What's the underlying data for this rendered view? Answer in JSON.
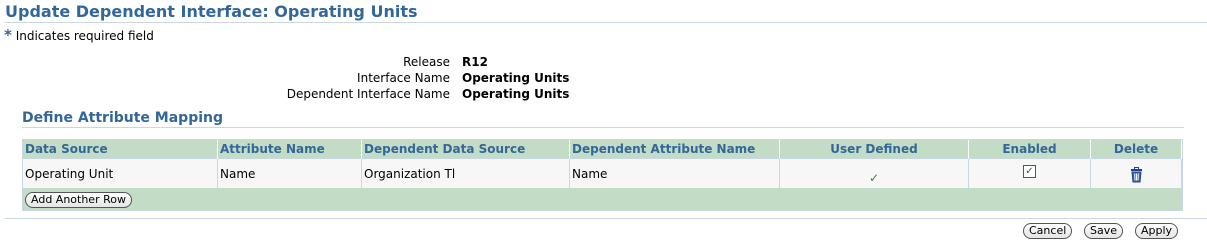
{
  "page": {
    "title": "Update Dependent Interface: Operating Units",
    "required_star": "*",
    "required_note": "Indicates required field"
  },
  "info": [
    {
      "label": "Release",
      "value": "R12"
    },
    {
      "label": "Interface Name",
      "value": "Operating Units"
    },
    {
      "label": "Dependent Interface Name",
      "value": "Operating Units"
    }
  ],
  "section": {
    "title": "Define Attribute Mapping"
  },
  "table": {
    "headers": [
      "Data Source",
      "Attribute Name",
      "Dependent Data Source",
      "Dependent Attribute Name",
      "User Defined",
      "Enabled",
      "Delete"
    ],
    "rows": [
      {
        "data_source": "Operating Unit",
        "attribute_name": "Name",
        "dependent_data_source": "Organization Tl",
        "dependent_attribute_name": "Name",
        "user_defined": true,
        "enabled": true
      }
    ],
    "add_row_label": "Add Another Row"
  },
  "icons": {
    "user_defined": "check-icon",
    "enabled": "checkbox-checked",
    "delete": "trash-icon",
    "check_glyph": "✓"
  },
  "buttons": {
    "cancel": "Cancel",
    "save": "Save",
    "apply": "Apply"
  },
  "colors": {
    "title": "#336699",
    "header_bg": "#c2dcc5",
    "row_bg": "#f7f7f7"
  }
}
